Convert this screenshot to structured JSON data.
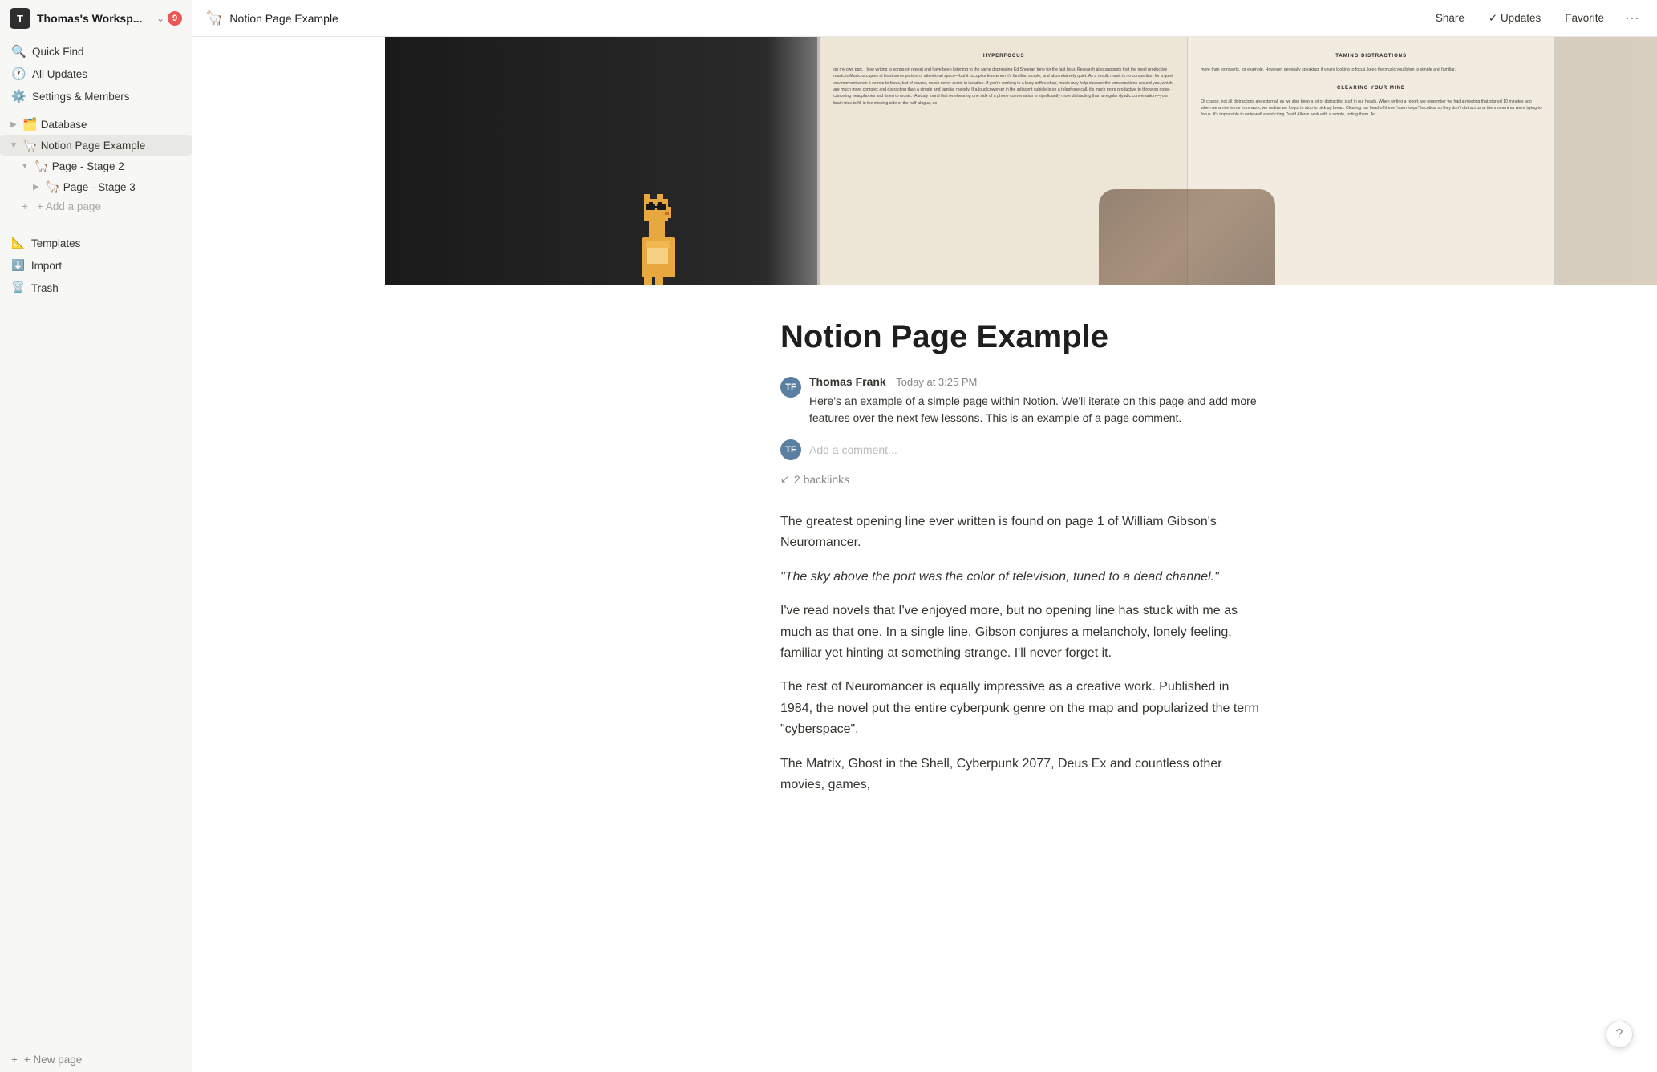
{
  "workspace": {
    "icon_letter": "T",
    "name": "Thomas's Worksp...",
    "notification_count": "9"
  },
  "sidebar": {
    "nav_items": [
      {
        "id": "quick-find",
        "icon": "🔍",
        "label": "Quick Find"
      },
      {
        "id": "all-updates",
        "icon": "🕐",
        "label": "All Updates"
      },
      {
        "id": "settings",
        "icon": "⚙️",
        "label": "Settings & Members"
      }
    ],
    "tree_items": [
      {
        "id": "database",
        "icon": "🗂️",
        "label": "Database",
        "depth": 0,
        "expanded": false,
        "has_arrow": false
      },
      {
        "id": "notion-page-example",
        "icon": "🦙",
        "label": "Notion Page Example",
        "depth": 0,
        "expanded": true,
        "has_arrow": true,
        "active": true
      },
      {
        "id": "page-stage2",
        "icon": "🦙",
        "label": "Page - Stage 2",
        "depth": 1,
        "expanded": true,
        "has_arrow": true
      },
      {
        "id": "page-stage3",
        "icon": "🦙",
        "label": "Page - Stage 3",
        "depth": 2,
        "expanded": false,
        "has_arrow": true
      }
    ],
    "add_page_label": "+ Add a page",
    "bottom_items": [
      {
        "id": "templates",
        "icon": "📐",
        "label": "Templates"
      },
      {
        "id": "import",
        "icon": "⬇️",
        "label": "Import"
      },
      {
        "id": "trash",
        "icon": "🗑️",
        "label": "Trash"
      }
    ],
    "new_page_label": "+ New page"
  },
  "topbar": {
    "page_icon": "🦙",
    "page_title": "Notion Page Example",
    "share_label": "Share",
    "updates_label": "Updates",
    "updates_icon": "✓",
    "favorite_label": "Favorite",
    "more_label": "···"
  },
  "page": {
    "title": "Notion Page Example",
    "author": {
      "name": "Thomas Frank",
      "timestamp": "Today at 3:25 PM",
      "avatar_initials": "TF",
      "comment": "Here's an example of a simple page within Notion. We'll iterate on this page and add more features over the next few lessons. This is an example of a page comment."
    },
    "comment_placeholder": "Add a comment...",
    "backlinks_label": "2 backlinks",
    "body_paragraphs": [
      {
        "id": "p1",
        "text": "The greatest opening line ever written is found on page 1 of William Gibson's Neuromancer.",
        "quote": false
      },
      {
        "id": "p2",
        "text": "\"The sky above the port was the color of television, tuned to a dead channel.\"",
        "quote": true
      },
      {
        "id": "p3",
        "text": "I've read novels that I've enjoyed more, but no opening line has stuck with me as much as that one. In a single line, Gibson conjures a melancholy, lonely feeling, familiar yet hinting at something strange. I'll never forget it.",
        "quote": false
      },
      {
        "id": "p4",
        "text": "The rest of Neuromancer is equally impressive as a creative work. Published in 1984, the novel put the entire cyberpunk genre on the map and popularized the term \"cyberspace\".",
        "quote": false
      },
      {
        "id": "p5",
        "text": "The Matrix, Ghost in the Shell, Cyberpunk 2077, Deus Ex and countless other movies, games,",
        "quote": false
      }
    ]
  },
  "help": {
    "label": "?"
  }
}
